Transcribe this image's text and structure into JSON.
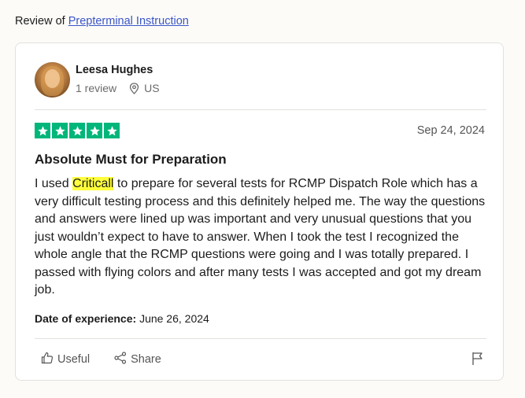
{
  "header": {
    "prefix": "Review of",
    "company_link": "Prepterminal Instruction"
  },
  "reviewer": {
    "name": "Leesa Hughes",
    "review_count": "1 review",
    "country": "US"
  },
  "review": {
    "rating": 5,
    "date": "Sep 24, 2024",
    "title": "Absolute Must for Preparation",
    "body_before": "I used ",
    "body_highlight": "Criticall",
    "body_after": " to prepare for several tests for RCMP Dispatch Role which has a very difficult testing process and this definitely helped me. The way the questions and answers were lined up was important and very unusual questions that you just wouldn’t expect to have to answer. When I took the test I recognized the whole angle that the RCMP questions were going and I was totally prepared. I passed with flying colors and after many tests I was accepted and got my dream job.",
    "experience_label": "Date of experience:",
    "experience_date": "June 26, 2024"
  },
  "actions": {
    "useful_label": "Useful",
    "share_label": "Share",
    "useful_icon": "thumbs-up-icon",
    "share_icon": "share-icon",
    "report_icon": "flag-icon"
  },
  "colors": {
    "star_green": "#00b67a",
    "link_blue": "#3a55c8",
    "highlight": "#ffff3b"
  }
}
